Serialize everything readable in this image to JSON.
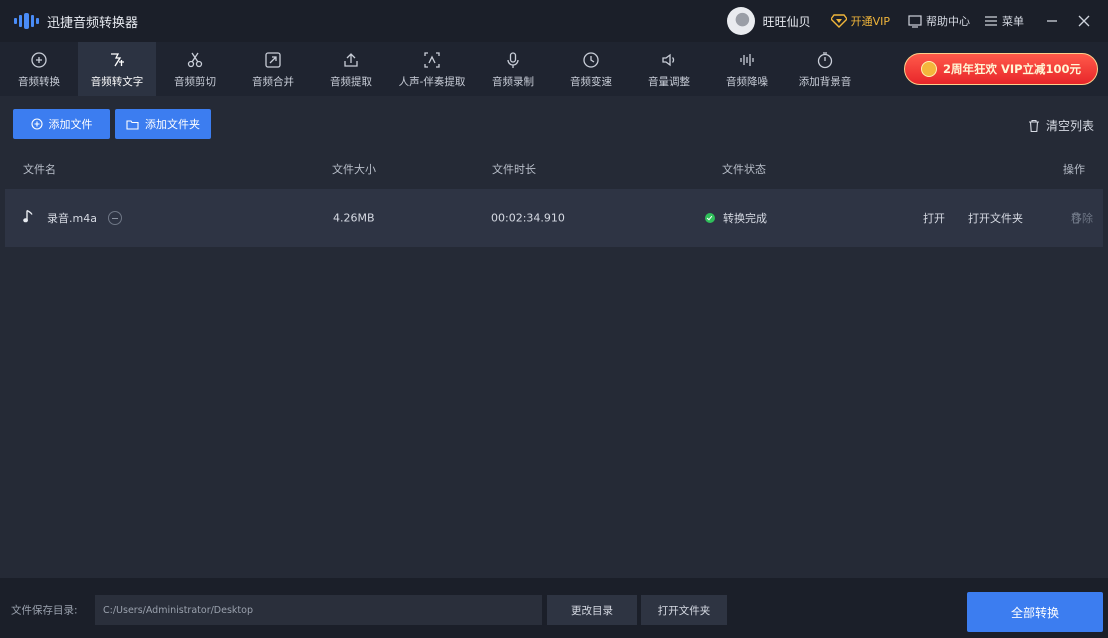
{
  "app": {
    "title": "迅捷音频转换器"
  },
  "user": {
    "name": "旺旺仙贝",
    "vip_label": "开通VIP"
  },
  "header": {
    "help_label": "帮助中心",
    "menu_label": "菜单"
  },
  "toolbar": {
    "items": [
      {
        "label": "音频转换"
      },
      {
        "label": "音频转文字"
      },
      {
        "label": "音频剪切"
      },
      {
        "label": "音频合并"
      },
      {
        "label": "音频提取"
      },
      {
        "label": "人声-伴奏提取"
      },
      {
        "label": "音频录制"
      },
      {
        "label": "音频变速"
      },
      {
        "label": "音量调整"
      },
      {
        "label": "音频降噪"
      },
      {
        "label": "添加背景音"
      }
    ],
    "active_index": 1
  },
  "promo": {
    "label": "2周年狂欢 VIP立减100元"
  },
  "actions": {
    "add_file": "添加文件",
    "add_folder": "添加文件夹",
    "clear_list": "清空列表"
  },
  "table": {
    "columns": [
      "文件名",
      "文件大小",
      "文件时长",
      "文件状态",
      "操作"
    ],
    "rows": [
      {
        "name": "录音.m4a",
        "size": "4.26MB",
        "duration": "00:02:34.910",
        "status": "转换完成",
        "open": "打开",
        "open_folder": "打开文件夹",
        "remove": "移除"
      }
    ]
  },
  "footer": {
    "save_label": "文件保存目录:",
    "path": "C:/Users/Administrator/Desktop",
    "change_dir": "更改目录",
    "open_folder": "打开文件夹",
    "convert_all": "全部转换"
  },
  "colors": {
    "accent": "#3c7df0",
    "success": "#2fbf5a",
    "vip": "#f0b53a",
    "promo": "#e8262a"
  }
}
